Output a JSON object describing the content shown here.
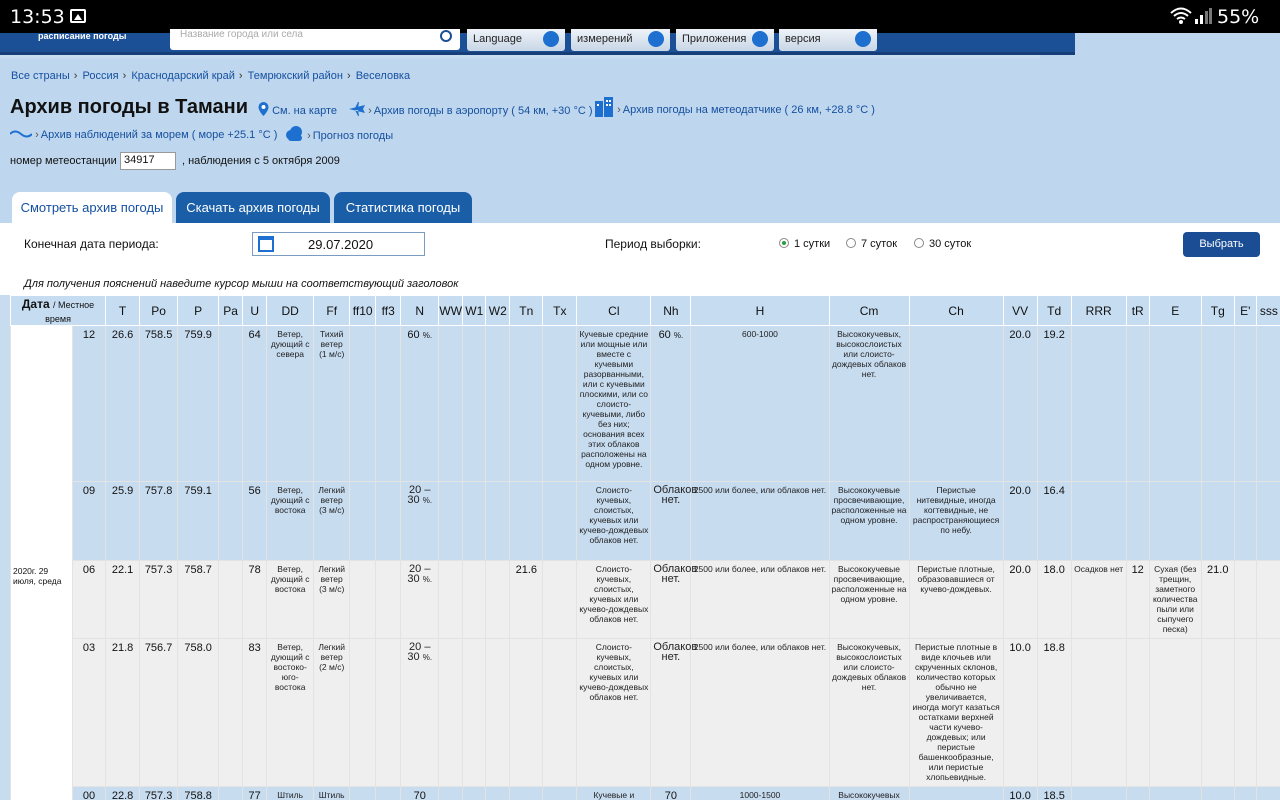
{
  "statusbar": {
    "time": "13:53",
    "battery": "55%"
  },
  "header": {
    "logo": "расписание погоды",
    "search_placeholder": "Название города или села",
    "language_label": "Language",
    "units_label": "измерений",
    "apps_label": "Приложения",
    "version_label": "версия"
  },
  "breadcrumbs": [
    "Все страны",
    "Россия",
    "Краснодарский край",
    "Темрюкский район",
    "Веселовка"
  ],
  "page_title": "Архив погоды в Тамани",
  "links": {
    "map": "См. на карте",
    "airport": "Архив погоды в аэропорту ( 54 км, +30 °C )",
    "sensor": "Архив погоды на метеодатчике ( 26 км, +28.8 °C )",
    "sea": "Архив наблюдений за морем ( море +25.1 °C )",
    "forecast": "Прогноз погоды"
  },
  "station": {
    "label": "номер метеостанции",
    "number": "34917",
    "since": ", наблюдения с 5 октября 2009"
  },
  "tabs": [
    "Смотреть архив погоды",
    "Скачать архив погоды",
    "Статистика погоды"
  ],
  "controls": {
    "end_date_label": "Конечная дата периода:",
    "end_date": "29.07.2020",
    "period_label": "Период выборки:",
    "periods": [
      "1 сутки",
      "7 суток",
      "30 суток"
    ],
    "selected_period": "1 сутки",
    "select_button": "Выбрать",
    "hint": "Для получения пояснений наведите курсор мыши на соответствующий заголовок"
  },
  "table": {
    "date_header": "Дата",
    "local_time_header": "/ Местное время",
    "columns": [
      "T",
      "Po",
      "P",
      "Pa",
      "U",
      "DD",
      "Ff",
      "ff10",
      "ff3",
      "N",
      "WW",
      "W1",
      "W2",
      "Tn",
      "Tx",
      "Cl",
      "Nh",
      "H",
      "Cm",
      "Ch",
      "VV",
      "Td",
      "RRR",
      "tR",
      "E",
      "Tg",
      "E'",
      "sss"
    ],
    "date_cell": "2020г. 29 июля, среда",
    "rows": [
      {
        "time": "12",
        "T": "26.6",
        "Po": "758.5",
        "P": "759.9",
        "Pa": "",
        "U": "64",
        "DD": "Ветер, дующий с севера",
        "Ff": "Тихий ветер (1 м/с)",
        "N": "60",
        "Nunit": "%.",
        "Tn": "",
        "Cl": "Кучевые средние или мощные или вместе с кучевыми разорванными, или с кучевыми плоскими, или со слоисто-кучевыми, либо без них; основания всех этих облаков расположены на одном уровне.",
        "Nh": "60",
        "Nhunit": "%.",
        "H": "600-1000",
        "Cm": "Высококучевых, высокослоистых или слоисто-дождевых облаков нет.",
        "Ch": "",
        "VV": "20.0",
        "Td": "19.2",
        "RRR": "",
        "tR": "",
        "E": "",
        "Tg": ""
      },
      {
        "time": "09",
        "T": "25.9",
        "Po": "757.8",
        "P": "759.1",
        "Pa": "",
        "U": "56",
        "DD": "Ветер, дующий с востока",
        "Ff": "Легкий ветер (3 м/с)",
        "N": "20 – 30",
        "Nunit": "%.",
        "Tn": "",
        "Cl": "Слоисто-кучевых, слоистых, кучевых или кучево-дождевых облаков нет.",
        "Nh": "Облаков нет.",
        "Nhunit": "",
        "H": "2500 или более, или облаков нет.",
        "Cm": "Высококучевые просвечивающие, расположенные на одном уровне.",
        "Ch": "Перистые нитевидные, иногда когтевидные, не распространяющиеся по небу.",
        "VV": "20.0",
        "Td": "16.4",
        "RRR": "",
        "tR": "",
        "E": "",
        "Tg": ""
      },
      {
        "time": "06",
        "T": "22.1",
        "Po": "757.3",
        "P": "758.7",
        "Pa": "",
        "U": "78",
        "DD": "Ветер, дующий с востока",
        "Ff": "Легкий ветер (3 м/с)",
        "N": "20 – 30",
        "Nunit": "%.",
        "Tn": "21.6",
        "Cl": "Слоисто-кучевых, слоистых, кучевых или кучево-дождевых облаков нет.",
        "Nh": "Облаков нет.",
        "Nhunit": "",
        "H": "2500 или более, или облаков нет.",
        "Cm": "Высококучевые просвечивающие, расположенные на одном уровне.",
        "Ch": "Перистые плотные, образовавшиеся от кучево-дождевых.",
        "VV": "20.0",
        "Td": "18.0",
        "RRR": "Осадков нет",
        "tR": "12",
        "E": "Сухая (без трещин, заметного количества пыли или сыпучего песка)",
        "Tg": "21.0"
      },
      {
        "time": "03",
        "T": "21.8",
        "Po": "756.7",
        "P": "758.0",
        "Pa": "",
        "U": "83",
        "DD": "Ветер, дующий с востоко-юго-востока",
        "Ff": "Легкий ветер (2 м/с)",
        "N": "20 – 30",
        "Nunit": "%.",
        "Tn": "",
        "Cl": "Слоисто-кучевых, слоистых, кучевых или кучево-дождевых облаков нет.",
        "Nh": "Облаков нет.",
        "Nhunit": "",
        "H": "2500 или более, или облаков нет.",
        "Cm": "Высококучевых, высокослоистых или слоисто-дождевых облаков нет.",
        "Ch": "Перистые плотные в виде клочьев или скрученных склонов, количество которых обычно не увеличивается, иногда могут казаться остатками верхней части кучево-дождевых; или перистые башенкообразные, или перистые хлопьевидные.",
        "VV": "10.0",
        "Td": "18.8",
        "RRR": "",
        "tR": "",
        "E": "",
        "Tg": ""
      },
      {
        "time": "00",
        "T": "22.8",
        "Po": "757.3",
        "P": "758.8",
        "Pa": "",
        "U": "77",
        "DD": "Штиль",
        "Ff": "Штиль",
        "N": "70",
        "Nunit": "",
        "Tn": "",
        "Cl": "Кучевые и",
        "Nh": "70",
        "Nhunit": "",
        "H": "1000-1500",
        "Cm": "Высококучевых",
        "Ch": "",
        "VV": "10.0",
        "Td": "18.5",
        "RRR": "",
        "tR": "",
        "E": "",
        "Tg": ""
      }
    ]
  }
}
